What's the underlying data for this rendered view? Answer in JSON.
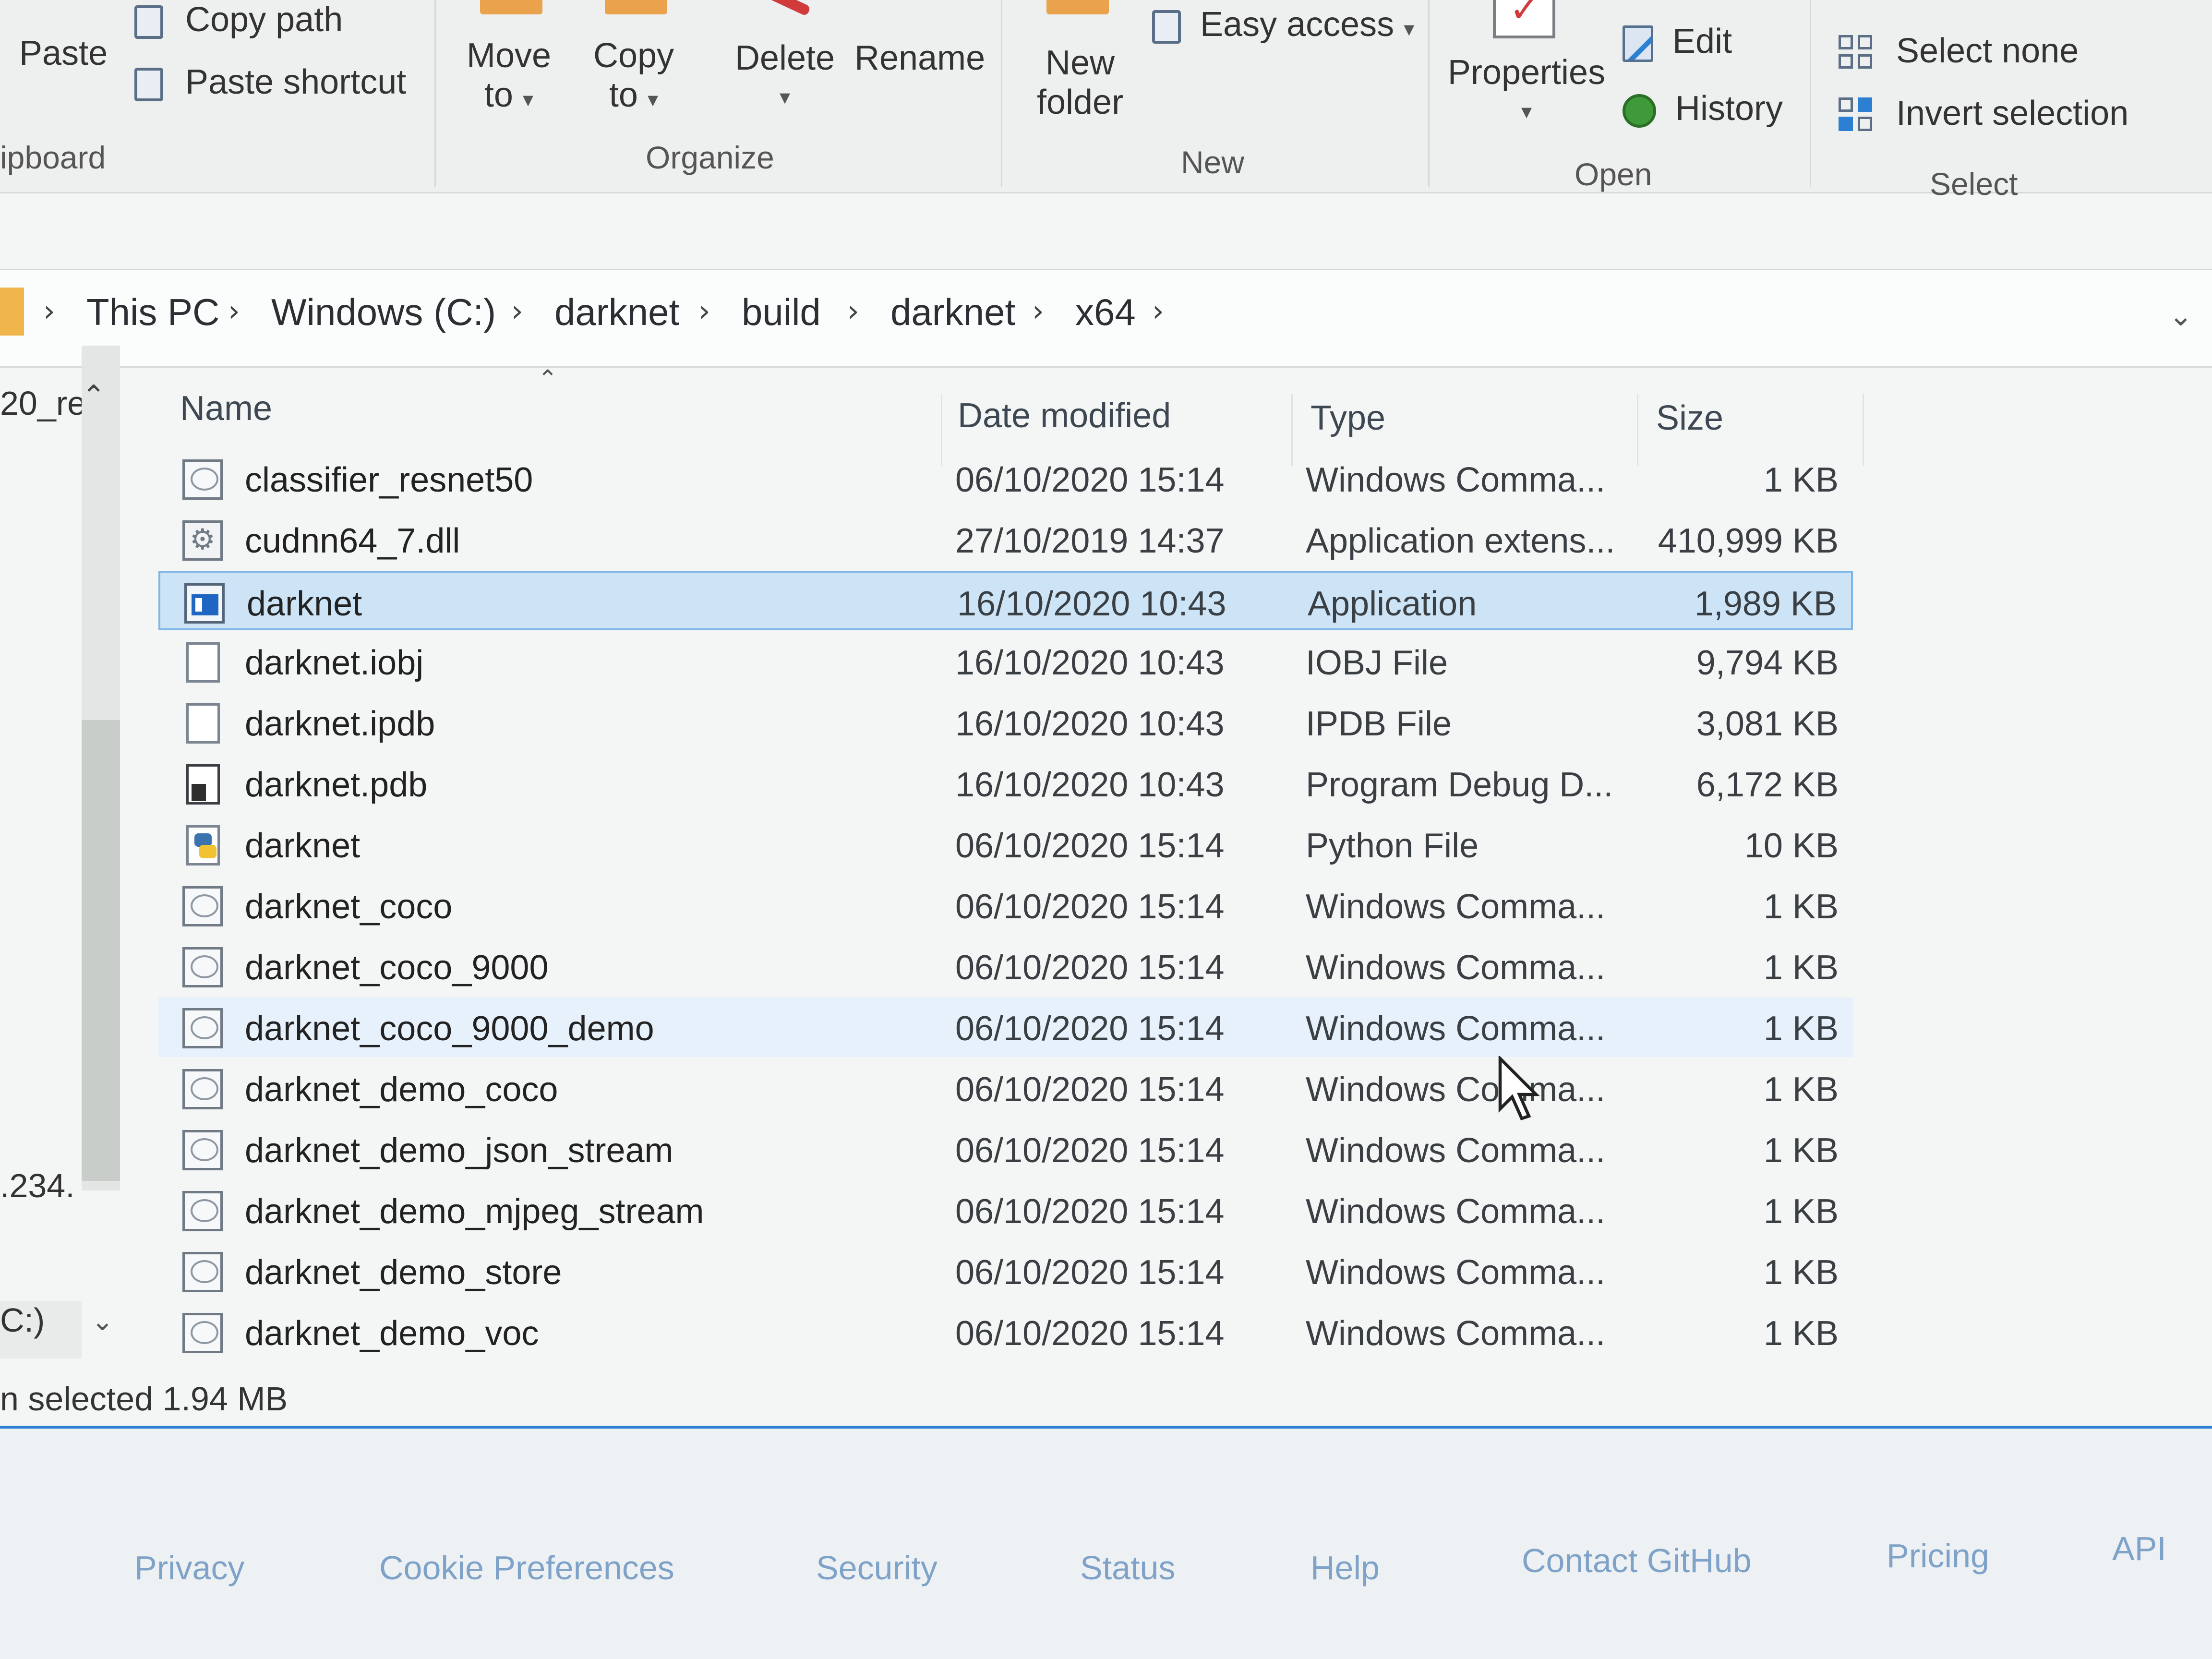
{
  "ribbon": {
    "clipboard": {
      "paste": "Paste",
      "copy_path": "Copy path",
      "paste_shortcut": "Paste shortcut",
      "label": "ipboard"
    },
    "organize": {
      "move_to_line1": "Move",
      "move_to_line2": "to",
      "copy_to_line1": "Copy",
      "copy_to_line2": "to",
      "delete": "Delete",
      "rename": "Rename",
      "label": "Organize"
    },
    "new": {
      "new_folder_line1": "New",
      "new_folder_line2": "folder",
      "easy_access": "Easy access",
      "label": "New"
    },
    "open": {
      "properties": "Properties",
      "edit": "Edit",
      "history": "History",
      "label": "Open"
    },
    "select": {
      "select_none": "Select none",
      "invert_selection": "Invert selection",
      "label": "Select"
    }
  },
  "address": {
    "crumbs": [
      "This PC",
      "Windows (C:)",
      "darknet",
      "build",
      "darknet",
      "x64"
    ]
  },
  "navpane": {
    "item_top": "20_re",
    "item_mid": ".234.",
    "item_drive": "C:)"
  },
  "columns": {
    "name": "Name",
    "date": "Date modified",
    "type": "Type",
    "size": "Size"
  },
  "files": [
    {
      "name": "classifier_resnet50",
      "date": "06/10/2020 15:14",
      "type": "Windows Comma...",
      "size": "1 KB",
      "icon": "cmd-file-icon"
    },
    {
      "name": "cudnn64_7.dll",
      "date": "27/10/2019 14:37",
      "type": "Application extens...",
      "size": "410,999 KB",
      "icon": "dll-file-icon"
    },
    {
      "name": "darknet",
      "date": "16/10/2020 10:43",
      "type": "Application",
      "size": "1,989 KB",
      "icon": "application-icon"
    },
    {
      "name": "darknet.iobj",
      "date": "16/10/2020 10:43",
      "type": "IOBJ File",
      "size": "9,794 KB",
      "icon": "blank-file-icon"
    },
    {
      "name": "darknet.ipdb",
      "date": "16/10/2020 10:43",
      "type": "IPDB File",
      "size": "3,081 KB",
      "icon": "blank-file-icon"
    },
    {
      "name": "darknet.pdb",
      "date": "16/10/2020 10:43",
      "type": "Program Debug D...",
      "size": "6,172 KB",
      "icon": "pdb-file-icon"
    },
    {
      "name": "darknet",
      "date": "06/10/2020 15:14",
      "type": "Python File",
      "size": "10 KB",
      "icon": "python-file-icon"
    },
    {
      "name": "darknet_coco",
      "date": "06/10/2020 15:14",
      "type": "Windows Comma...",
      "size": "1 KB",
      "icon": "cmd-file-icon"
    },
    {
      "name": "darknet_coco_9000",
      "date": "06/10/2020 15:14",
      "type": "Windows Comma...",
      "size": "1 KB",
      "icon": "cmd-file-icon"
    },
    {
      "name": "darknet_coco_9000_demo",
      "date": "06/10/2020 15:14",
      "type": "Windows Comma...",
      "size": "1 KB",
      "icon": "cmd-file-icon"
    },
    {
      "name": "darknet_demo_coco",
      "date": "06/10/2020 15:14",
      "type": "Windows Comma...",
      "size": "1 KB",
      "icon": "cmd-file-icon"
    },
    {
      "name": "darknet_demo_json_stream",
      "date": "06/10/2020 15:14",
      "type": "Windows Comma...",
      "size": "1 KB",
      "icon": "cmd-file-icon"
    },
    {
      "name": "darknet_demo_mjpeg_stream",
      "date": "06/10/2020 15:14",
      "type": "Windows Comma...",
      "size": "1 KB",
      "icon": "cmd-file-icon"
    },
    {
      "name": "darknet_demo_store",
      "date": "06/10/2020 15:14",
      "type": "Windows Comma...",
      "size": "1 KB",
      "icon": "cmd-file-icon"
    },
    {
      "name": "darknet_demo_voc",
      "date": "06/10/2020 15:14",
      "type": "Windows Comma...",
      "size": "1 KB",
      "icon": "cmd-file-icon"
    }
  ],
  "selected_index": 2,
  "hover_index": 9,
  "status": {
    "text": "n selected  1.94 MB"
  },
  "footer": {
    "links": [
      "Privacy",
      "Cookie Preferences",
      "Security",
      "Status",
      "Help",
      "Contact GitHub",
      "Pricing",
      "API"
    ]
  },
  "colors": {
    "selection_bg": "#cde4f7",
    "selection_border": "#7fb6e6",
    "accent": "#2d7fd3",
    "footer_link": "#7ea2c8"
  }
}
